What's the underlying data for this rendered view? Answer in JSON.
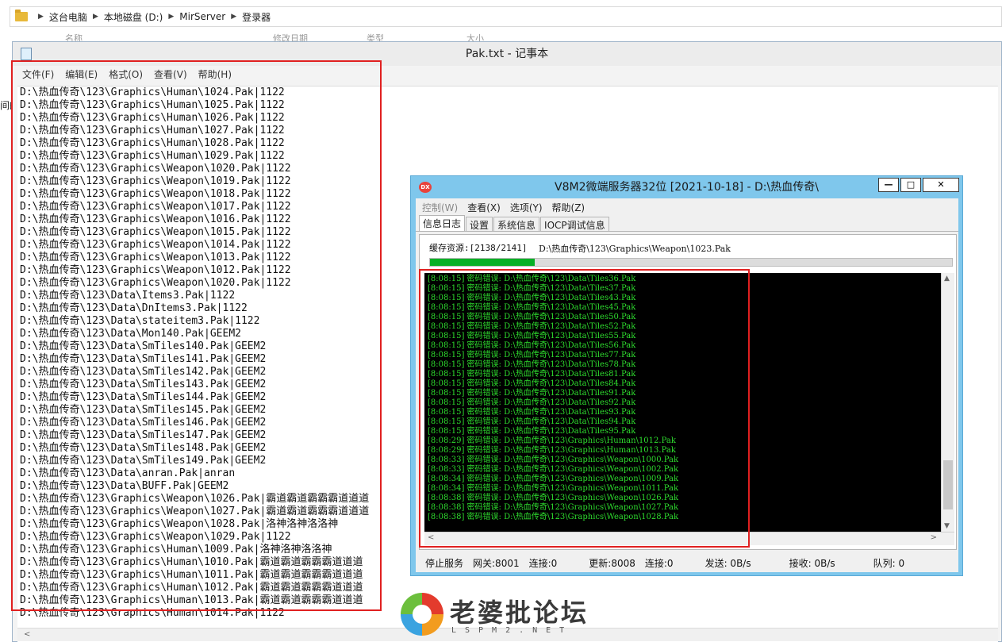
{
  "explorer": {
    "breadcrumb": [
      "这台电脑",
      "本地磁盘 (D:)",
      "MirServer",
      "登录器"
    ],
    "column_headers": [
      "名称",
      "修改日期",
      "类型",
      "大小"
    ],
    "left_fragment": "间的"
  },
  "notepad": {
    "title": "Pak.txt - 记事本",
    "menu": [
      "文件(F)",
      "编辑(E)",
      "格式(O)",
      "查看(V)",
      "帮助(H)"
    ],
    "lines": [
      "D:\\热血传奇\\123\\Graphics\\Human\\1024.Pak|1122",
      "D:\\热血传奇\\123\\Graphics\\Human\\1025.Pak|1122",
      "D:\\热血传奇\\123\\Graphics\\Human\\1026.Pak|1122",
      "D:\\热血传奇\\123\\Graphics\\Human\\1027.Pak|1122",
      "D:\\热血传奇\\123\\Graphics\\Human\\1028.Pak|1122",
      "D:\\热血传奇\\123\\Graphics\\Human\\1029.Pak|1122",
      "D:\\热血传奇\\123\\Graphics\\Weapon\\1020.Pak|1122",
      "D:\\热血传奇\\123\\Graphics\\Weapon\\1019.Pak|1122",
      "D:\\热血传奇\\123\\Graphics\\Weapon\\1018.Pak|1122",
      "D:\\热血传奇\\123\\Graphics\\Weapon\\1017.Pak|1122",
      "D:\\热血传奇\\123\\Graphics\\Weapon\\1016.Pak|1122",
      "D:\\热血传奇\\123\\Graphics\\Weapon\\1015.Pak|1122",
      "D:\\热血传奇\\123\\Graphics\\Weapon\\1014.Pak|1122",
      "D:\\热血传奇\\123\\Graphics\\Weapon\\1013.Pak|1122",
      "D:\\热血传奇\\123\\Graphics\\Weapon\\1012.Pak|1122",
      "D:\\热血传奇\\123\\Graphics\\Weapon\\1020.Pak|1122",
      "D:\\热血传奇\\123\\Data\\Items3.Pak|1122",
      "D:\\热血传奇\\123\\Data\\DnItems3.Pak|1122",
      "D:\\热血传奇\\123\\Data\\stateitem3.Pak|1122",
      "D:\\热血传奇\\123\\Data\\Mon140.Pak|GEEM2",
      "D:\\热血传奇\\123\\Data\\SmTiles140.Pak|GEEM2",
      "D:\\热血传奇\\123\\Data\\SmTiles141.Pak|GEEM2",
      "D:\\热血传奇\\123\\Data\\SmTiles142.Pak|GEEM2",
      "D:\\热血传奇\\123\\Data\\SmTiles143.Pak|GEEM2",
      "D:\\热血传奇\\123\\Data\\SmTiles144.Pak|GEEM2",
      "D:\\热血传奇\\123\\Data\\SmTiles145.Pak|GEEM2",
      "D:\\热血传奇\\123\\Data\\SmTiles146.Pak|GEEM2",
      "D:\\热血传奇\\123\\Data\\SmTiles147.Pak|GEEM2",
      "D:\\热血传奇\\123\\Data\\SmTiles148.Pak|GEEM2",
      "D:\\热血传奇\\123\\Data\\SmTiles149.Pak|GEEM2",
      "D:\\热血传奇\\123\\Data\\anran.Pak|anran",
      "D:\\热血传奇\\123\\Data\\BUFF.Pak|GEEM2",
      "D:\\热血传奇\\123\\Graphics\\Weapon\\1026.Pak|霸道霸道霸霸霸道道道",
      "D:\\热血传奇\\123\\Graphics\\Weapon\\1027.Pak|霸道霸道霸霸霸道道道",
      "D:\\热血传奇\\123\\Graphics\\Weapon\\1028.Pak|洛神洛神洛洛神",
      "D:\\热血传奇\\123\\Graphics\\Weapon\\1029.Pak|1122",
      "D:\\热血传奇\\123\\Graphics\\Human\\1009.Pak|洛神洛神洛洛神",
      "D:\\热血传奇\\123\\Graphics\\Human\\1010.Pak|霸道霸道霸霸霸道道道",
      "D:\\热血传奇\\123\\Graphics\\Human\\1011.Pak|霸道霸道霸霸霸道道道",
      "D:\\热血传奇\\123\\Graphics\\Human\\1012.Pak|霸道霸道霸霸霸道道道",
      "D:\\热血传奇\\123\\Graphics\\Human\\1013.Pak|霸道霸道霸霸霸道道道",
      "D:\\热血传奇\\123\\Graphics\\Human\\1014.Pak|1122"
    ]
  },
  "server": {
    "logo": "DX",
    "title": "V8M2微端服务器32位 [2021-10-18] - D:\\热血传奇\\",
    "win_buttons": {
      "minimize": "—",
      "maximize": "□",
      "close": "✕"
    },
    "menu": [
      {
        "label": "控制(W)",
        "enabled": false
      },
      {
        "label": "查看(X)",
        "enabled": true
      },
      {
        "label": "选项(Y)",
        "enabled": true
      },
      {
        "label": "帮助(Z)",
        "enabled": true
      }
    ],
    "tabs": [
      "信息日志",
      "设置",
      "系统信息",
      "IOCP调试信息"
    ],
    "active_tab": "信息日志",
    "cache_label": "缓存资源:[2138/2141]",
    "cache_path": "D:\\热血传奇\\123\\Graphics\\Weapon\\1023.Pak",
    "progress": 0.2,
    "log": [
      "[8:08:15] 密码错误: D:\\热血传奇\\123\\Data\\Tiles36.Pak",
      "[8:08:15] 密码错误: D:\\热血传奇\\123\\Data\\Tiles37.Pak",
      "[8:08:15] 密码错误: D:\\热血传奇\\123\\Data\\Tiles43.Pak",
      "[8:08:15] 密码错误: D:\\热血传奇\\123\\Data\\Tiles45.Pak",
      "[8:08:15] 密码错误: D:\\热血传奇\\123\\Data\\Tiles50.Pak",
      "[8:08:15] 密码错误: D:\\热血传奇\\123\\Data\\Tiles52.Pak",
      "[8:08:15] 密码错误: D:\\热血传奇\\123\\Data\\Tiles55.Pak",
      "[8:08:15] 密码错误: D:\\热血传奇\\123\\Data\\Tiles56.Pak",
      "[8:08:15] 密码错误: D:\\热血传奇\\123\\Data\\Tiles77.Pak",
      "[8:08:15] 密码错误: D:\\热血传奇\\123\\Data\\Tiles78.Pak",
      "[8:08:15] 密码错误: D:\\热血传奇\\123\\Data\\Tiles81.Pak",
      "[8:08:15] 密码错误: D:\\热血传奇\\123\\Data\\Tiles84.Pak",
      "[8:08:15] 密码错误: D:\\热血传奇\\123\\Data\\Tiles91.Pak",
      "[8:08:15] 密码错误: D:\\热血传奇\\123\\Data\\Tiles92.Pak",
      "[8:08:15] 密码错误: D:\\热血传奇\\123\\Data\\Tiles93.Pak",
      "[8:08:15] 密码错误: D:\\热血传奇\\123\\Data\\Tiles94.Pak",
      "[8:08:15] 密码错误: D:\\热血传奇\\123\\Data\\Tiles95.Pak",
      "[8:08:29] 密码错误: D:\\热血传奇\\123\\Graphics\\Human\\1012.Pak",
      "[8:08:29] 密码错误: D:\\热血传奇\\123\\Graphics\\Human\\1013.Pak",
      "[8:08:33] 密码错误: D:\\热血传奇\\123\\Graphics\\Weapon\\1000.Pak",
      "[8:08:33] 密码错误: D:\\热血传奇\\123\\Graphics\\Weapon\\1002.Pak",
      "[8:08:34] 密码错误: D:\\热血传奇\\123\\Graphics\\Weapon\\1009.Pak",
      "[8:08:34] 密码错误: D:\\热血传奇\\123\\Graphics\\Weapon\\1011.Pak",
      "[8:08:38] 密码错误: D:\\热血传奇\\123\\Graphics\\Weapon\\1026.Pak",
      "[8:08:38] 密码错误: D:\\热血传奇\\123\\Graphics\\Weapon\\1027.Pak",
      "[8:08:38] 密码错误: D:\\热血传奇\\123\\Graphics\\Weapon\\1028.Pak"
    ],
    "status": {
      "stop": "停止服务",
      "gateway": "网关:8001",
      "gateway_conn": "连接:0",
      "update": "更新:8008",
      "update_conn": "连接:0",
      "send": "发送: 0B/s",
      "recv": "接收: 0B/s",
      "queue": "队列: 0"
    },
    "colors": {
      "title_bar": "#7fc7ec",
      "log_text": "#2edc2e",
      "progress": "#06b025"
    }
  },
  "watermark": {
    "text": "老婆批论坛",
    "sub": "LSPM2.NET"
  },
  "highlight_color": "#e02020"
}
